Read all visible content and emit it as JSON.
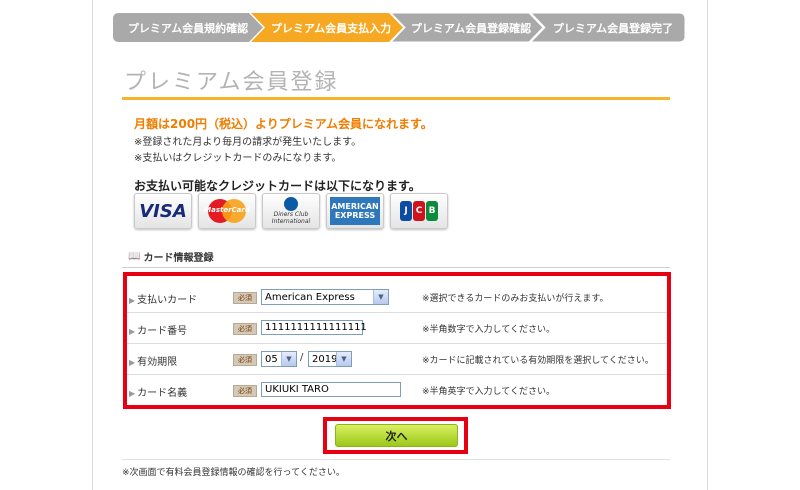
{
  "steps": [
    {
      "label": "プレミアム会員規約確認",
      "active": false
    },
    {
      "label": "プレミアム会員支払入力",
      "active": true
    },
    {
      "label": "プレミアム会員登録確認",
      "active": false
    },
    {
      "label": "プレミアム会員登録完了",
      "active": false
    }
  ],
  "colors": {
    "step_active": "#f7a822",
    "step_inactive": "#a9a9a9",
    "accent": "#ee7d00",
    "highlight": "#e60012",
    "button": "#b4dc2c"
  },
  "page_title": "プレミアム会員登録",
  "lead": "月額は200円（税込）よりプレミアム会員になれます。",
  "notes": [
    "※登録された月より毎月の請求が発生いたします。",
    "※支払いはクレジットカードのみになります。"
  ],
  "cards_heading": "お支払い可能なクレジットカードは以下になります。",
  "card_brands": {
    "visa": "VISA",
    "mastercard": "MasterCard",
    "diners": "Diners Club International",
    "amex_line1": "AMERICAN",
    "amex_line2": "EXPRESS",
    "jcb": [
      "J",
      "C",
      "B"
    ]
  },
  "section_title": "カード情報登録",
  "required_label": "必須",
  "form": {
    "card_type": {
      "label": "支払いカード",
      "value": "American Express",
      "note": "※選択できるカードのみお支払いが行えます。"
    },
    "card_number": {
      "label": "カード番号",
      "value": "1111111111111111",
      "note": "※半角数字で入力してください。"
    },
    "expiry": {
      "label": "有効期限",
      "month": "05",
      "year": "2019",
      "separator": "/",
      "note": "※カードに記載されている有効期限を選択してください。"
    },
    "card_name": {
      "label": "カード名義",
      "value": "UKIUKI TARO",
      "note": "※半角英字で入力してください。"
    }
  },
  "next_button": "次へ",
  "footer_note": "※次画面で有料会員登録情報の確認を行ってください。"
}
